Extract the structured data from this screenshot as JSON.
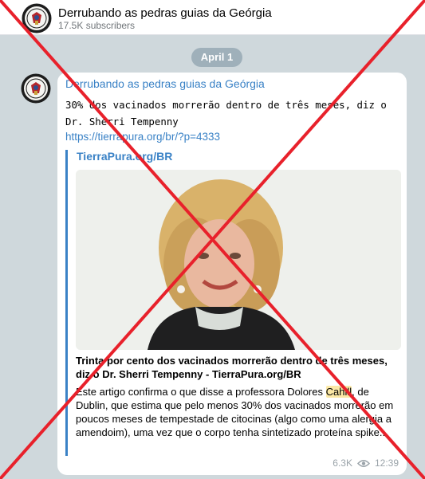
{
  "header": {
    "channel_name": "Derrubando as pedras guias da Geórgia",
    "subscribers": "17.5K subscribers"
  },
  "date_pill": "April 1",
  "post": {
    "channel_name": "Derrubando as pedras guias da Geórgia",
    "text": "30% dos vacinados morrerão dentro de três meses, diz o Dr. Sherri Tempenny",
    "link": "https://tierrapura.org/br/?p=4333",
    "preview": {
      "site": "TierraPura.org/BR",
      "title": "Trinta por cento dos vacinados morrerão dentro de três meses, diz o Dr. Sherri Tempenny - TierraPura.org/BR",
      "desc_before": "Este artigo confirma o que disse a professora Dolores ",
      "desc_highlight": "Cahill",
      "desc_after": ", de Dublin, que estima que pelo menos 30% dos vacinados morrerão em poucos meses de tempestade de citocinas (algo como uma alergia a amendoim), uma vez que o corpo tenha sintetizado proteína spike..."
    },
    "views": "6.3K",
    "time": "12:39"
  },
  "icons": {
    "channel_avatar": "channel-seal-avatar",
    "views": "eye-icon"
  },
  "colors": {
    "accent": "#3a82c6",
    "overlay_x": "#e8212b",
    "background": "#cfd8dc"
  }
}
